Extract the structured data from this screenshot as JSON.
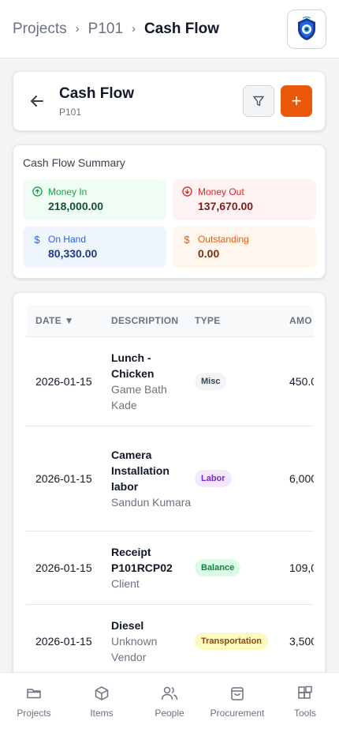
{
  "breadcrumb": {
    "items": [
      "Projects",
      "P101",
      "Cash Flow"
    ]
  },
  "header": {
    "title": "Cash Flow",
    "subtitle": "P101",
    "add_label": "+"
  },
  "summary": {
    "title": "Cash Flow Summary",
    "money_in": {
      "label": "Money In",
      "value": "218,000.00"
    },
    "money_out": {
      "label": "Money Out",
      "value": "137,670.00"
    },
    "on_hand": {
      "label": "On Hand",
      "value": "80,330.00",
      "icon": "$"
    },
    "outstanding": {
      "label": "Outstanding",
      "value": "0.00",
      "icon": "$"
    }
  },
  "table": {
    "columns": {
      "date": "DATE ▼",
      "description": "DESCRIPTION",
      "type": "TYPE",
      "amount": "AMO"
    },
    "rows": [
      {
        "date": "2026-01-15",
        "desc_main": "Lunch - Chicken",
        "desc_sub": "Game Bath Kade",
        "type": "Misc",
        "amount": "450.0"
      },
      {
        "date": "2026-01-15",
        "desc_main": "Camera Installation labor",
        "desc_sub": "Sandun Kumara",
        "type": "Labor",
        "amount": "6,000"
      },
      {
        "date": "2026-01-15",
        "desc_main": "Receipt P101RCP02",
        "desc_sub": "Client",
        "type": "Balance",
        "amount": "109,0"
      },
      {
        "date": "2026-01-15",
        "desc_main": "Diesel",
        "desc_sub": "Unknown Vendor",
        "type": "Transportation",
        "amount": "3,500"
      }
    ]
  },
  "nav": {
    "projects": "Projects",
    "items": "Items",
    "people": "People",
    "procurement": "Procurement",
    "tools": "Tools"
  },
  "colors": {
    "accent": "#ea580c"
  }
}
